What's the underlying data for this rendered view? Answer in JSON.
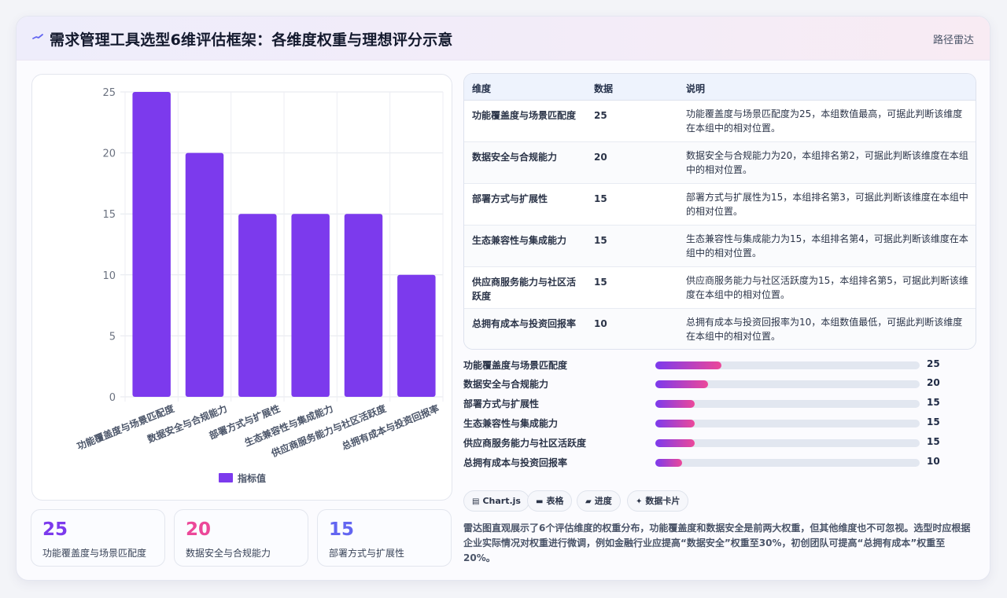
{
  "header": {
    "title": "需求管理工具选型6维评估框架：各维度权重与理想评分示意",
    "right_label": "路径雷达"
  },
  "chart_data": {
    "type": "bar",
    "categories": [
      "功能覆盖度与场景匹配度",
      "数据安全与合规能力",
      "部署方式与扩展性",
      "生态兼容性与集成能力",
      "供应商服务能力与社区活跃度",
      "总拥有成本与投资回报率"
    ],
    "series": [
      {
        "name": "指标值",
        "values": [
          25,
          20,
          15,
          15,
          15,
          10
        ]
      }
    ],
    "ylim": [
      0,
      25
    ],
    "yticks": [
      0,
      5,
      10,
      15,
      20,
      25
    ],
    "grid": true,
    "legend": "bottom",
    "bar_color": "#7c3aed"
  },
  "stats": [
    {
      "value": "25",
      "label": "功能覆盖度与场景匹配度",
      "color": "#7c3aed"
    },
    {
      "value": "20",
      "label": "数据安全与合规能力",
      "color": "#ec4899"
    },
    {
      "value": "15",
      "label": "部署方式与扩展性",
      "color": "#6366f1"
    }
  ],
  "table": {
    "headers": [
      "维度",
      "数据",
      "说明"
    ],
    "rows": [
      {
        "name": "功能覆盖度与场景匹配度",
        "value": "25",
        "desc": "功能覆盖度与场景匹配度为25，本组数值最高，可据此判断该维度在本组中的相对位置。"
      },
      {
        "name": "数据安全与合规能力",
        "value": "20",
        "desc": "数据安全与合规能力为20，本组排名第2，可据此判断该维度在本组中的相对位置。"
      },
      {
        "name": "部署方式与扩展性",
        "value": "15",
        "desc": "部署方式与扩展性为15，本组排名第3，可据此判断该维度在本组中的相对位置。"
      },
      {
        "name": "生态兼容性与集成能力",
        "value": "15",
        "desc": "生态兼容性与集成能力为15，本组排名第4，可据此判断该维度在本组中的相对位置。"
      },
      {
        "name": "供应商服务能力与社区活跃度",
        "value": "15",
        "desc": "供应商服务能力与社区活跃度为15，本组排名第5，可据此判断该维度在本组中的相对位置。"
      },
      {
        "name": "总拥有成本与投资回报率",
        "value": "10",
        "desc": "总拥有成本与投资回报率为10，本组数值最低，可据此判断该维度在本组中的相对位置。"
      }
    ]
  },
  "progress": {
    "max": 100,
    "items": [
      {
        "label": "功能覆盖度与场景匹配度",
        "value": 25
      },
      {
        "label": "数据安全与合规能力",
        "value": 20
      },
      {
        "label": "部署方式与扩展性",
        "value": 15
      },
      {
        "label": "生态兼容性与集成能力",
        "value": 15
      },
      {
        "label": "供应商服务能力与社区活跃度",
        "value": 15
      },
      {
        "label": "总拥有成本与投资回报率",
        "value": 10
      }
    ]
  },
  "chips": [
    {
      "icon": "chart-icon",
      "glyph": "▤",
      "label": "Chart.js"
    },
    {
      "icon": "table-icon",
      "glyph": "▬",
      "label": "表格"
    },
    {
      "icon": "progress-icon",
      "glyph": "▰",
      "label": "进度"
    },
    {
      "icon": "card-icon",
      "glyph": "✦",
      "label": "数据卡片"
    }
  ],
  "summary": "雷达图直观展示了6个评估维度的权重分布，功能覆盖度和数据安全是前两大权重，但其他维度也不可忽视。选型时应根据企业实际情况对权重进行微调，例如金融行业应提高“数据安全”权重至30%，初创团队可提高“总拥有成本”权重至20%。"
}
